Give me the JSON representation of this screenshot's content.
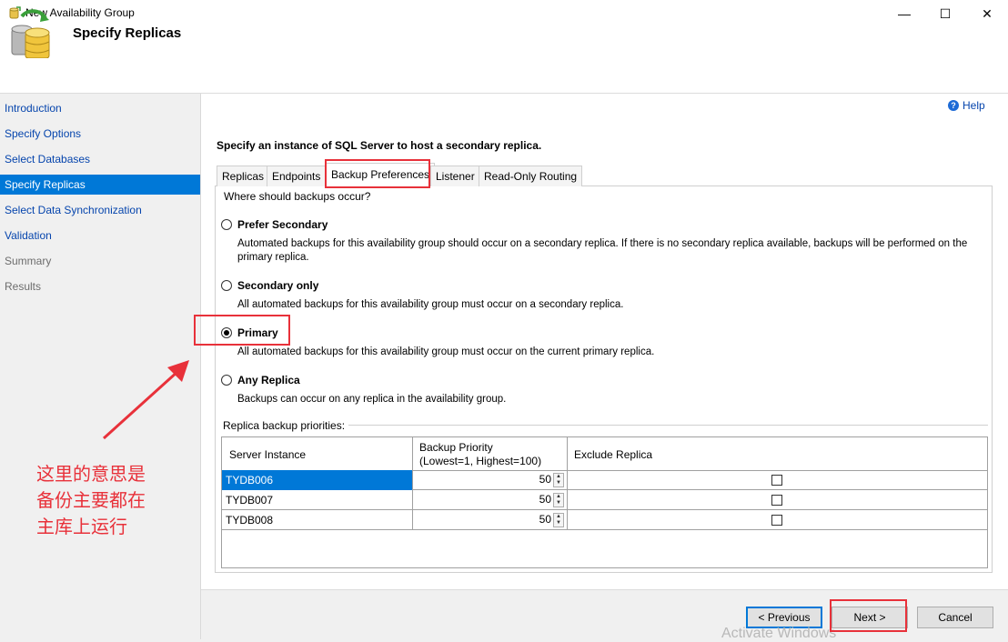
{
  "window": {
    "title": "New Availability Group",
    "minimize": "—",
    "maximize": "☐",
    "close": "✕"
  },
  "header": {
    "title": "Specify Replicas"
  },
  "sidebar": {
    "items": [
      {
        "label": "Introduction",
        "state": "link"
      },
      {
        "label": "Specify Options",
        "state": "link"
      },
      {
        "label": "Select Databases",
        "state": "link"
      },
      {
        "label": "Specify Replicas",
        "state": "selected"
      },
      {
        "label": "Select Data Synchronization",
        "state": "link"
      },
      {
        "label": "Validation",
        "state": "link"
      },
      {
        "label": "Summary",
        "state": "disabled"
      },
      {
        "label": "Results",
        "state": "disabled"
      }
    ]
  },
  "help": {
    "label": "Help",
    "icon": "help-icon"
  },
  "main": {
    "instruction": "Specify an instance of SQL Server to host a secondary replica.",
    "tabs": [
      {
        "label": "Replicas"
      },
      {
        "label": "Endpoints"
      },
      {
        "label": "Backup Preferences",
        "active": true
      },
      {
        "label": "Listener"
      },
      {
        "label": "Read-Only Routing"
      }
    ],
    "question": "Where should backups occur?",
    "options": [
      {
        "label": "Prefer Secondary",
        "desc": "Automated backups for this availability group should occur on a secondary replica. If there is no secondary replica available, backups will be performed on the primary replica.",
        "selected": false
      },
      {
        "label": "Secondary only",
        "desc": "All automated backups for this availability group must occur on a secondary replica.",
        "selected": false
      },
      {
        "label": "Primary",
        "desc": "All automated backups for this availability group must occur on the current primary replica.",
        "selected": true
      },
      {
        "label": "Any Replica",
        "desc": "Backups can occur on any replica in the availability group.",
        "selected": false
      }
    ],
    "priorities_label": "Replica backup priorities:",
    "grid": {
      "headers": {
        "instance": "Server Instance",
        "priority_line1": "Backup Priority",
        "priority_line2": "(Lowest=1, Highest=100)",
        "exclude": "Exclude Replica"
      },
      "rows": [
        {
          "instance": "TYDB006",
          "priority": "50",
          "exclude": false,
          "selected": true
        },
        {
          "instance": "TYDB007",
          "priority": "50",
          "exclude": false,
          "selected": false
        },
        {
          "instance": "TYDB008",
          "priority": "50",
          "exclude": false,
          "selected": false
        }
      ]
    }
  },
  "footer": {
    "previous": "< Previous",
    "next": "Next >",
    "cancel": "Cancel",
    "watermark": "Activate Windows"
  },
  "annotation": {
    "lines": [
      "这里的意思是",
      "备份主要都在",
      "主库上运行"
    ],
    "color": "#e8313a"
  },
  "colors": {
    "accent": "#0078d7",
    "link": "#0645ad",
    "annotation": "#e8313a"
  }
}
